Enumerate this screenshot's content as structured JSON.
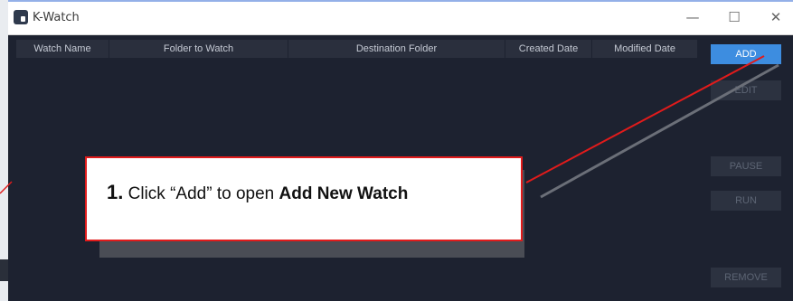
{
  "window": {
    "title": "K-Watch",
    "icon": "k-watch-app-icon",
    "controls": {
      "minimize": "—",
      "maximize": "☐",
      "close": "✕"
    }
  },
  "table": {
    "columns": [
      "Watch Name",
      "Folder to Watch",
      "Destination Folder",
      "Created Date",
      "Modified Date"
    ],
    "rows": []
  },
  "actions": {
    "add": "ADD",
    "edit": "EDIT",
    "pause": "PAUSE",
    "run": "RUN",
    "remove": "REMOVE"
  },
  "callout": {
    "step": "1.",
    "text_before": " Click “Add” to open ",
    "emphasis": "Add New Watch"
  },
  "colors": {
    "background": "#1d2230",
    "header": "#2a2f3d",
    "add_button": "#3d8de0",
    "callout_border": "#e11b1b",
    "pointer_line": "#e11b1b"
  }
}
